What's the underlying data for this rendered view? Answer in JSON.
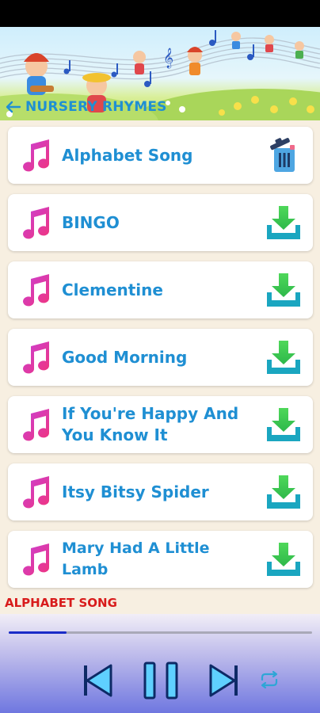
{
  "header": {
    "title": "NURSERY RHYMES",
    "back_icon": "back-arrow-icon"
  },
  "songs": [
    {
      "title": "Alphabet Song",
      "status": "downloaded",
      "action_icon": "trash-icon"
    },
    {
      "title": "BINGO",
      "status": "not-downloaded",
      "action_icon": "download-icon"
    },
    {
      "title": "Clementine",
      "status": "not-downloaded",
      "action_icon": "download-icon"
    },
    {
      "title": "Good Morning",
      "status": "not-downloaded",
      "action_icon": "download-icon"
    },
    {
      "title": "If You're Happy And You Know It",
      "status": "not-downloaded",
      "action_icon": "download-icon"
    },
    {
      "title": "Itsy Bitsy Spider",
      "status": "not-downloaded",
      "action_icon": "download-icon"
    },
    {
      "title": "Mary Had A Little Lamb",
      "status": "not-downloaded",
      "action_icon": "download-icon"
    }
  ],
  "player": {
    "now_playing": "ALPHABET SONG",
    "progress": 0.19,
    "controls": [
      "previous-icon",
      "pause-icon",
      "next-icon",
      "repeat-icon"
    ]
  },
  "colors": {
    "title_blue": "#1f8fd3",
    "now_playing_red": "#d81b1b",
    "note_gradient_start": "#c93fd6",
    "note_gradient_end": "#f0357e",
    "download_green": "#3ccf52",
    "download_teal": "#1aa6c0",
    "progress_blue": "#1a2cc7"
  }
}
